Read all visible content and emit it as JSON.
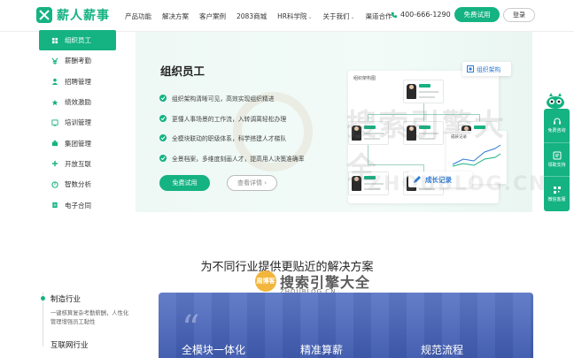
{
  "brand": {
    "name": "薪人薪事",
    "color": "#15b282"
  },
  "nav": {
    "items": [
      {
        "label": "产品功能",
        "caret": false
      },
      {
        "label": "解决方案",
        "caret": false
      },
      {
        "label": "客户案例",
        "caret": false
      },
      {
        "label": "2083商城",
        "caret": false
      },
      {
        "label": "HR科学院",
        "caret": true
      },
      {
        "label": "关于我们",
        "caret": true
      },
      {
        "label": "渠道合作",
        "caret": false
      }
    ],
    "caret_glyph": "⌄",
    "phone": "400-666-1290",
    "trial_label": "免费试用",
    "login_label": "登录"
  },
  "sidebar": {
    "items": [
      {
        "label": "组织员工",
        "icon": "org-icon"
      },
      {
        "label": "薪酬考勤",
        "icon": "yen-icon"
      },
      {
        "label": "招聘管理",
        "icon": "recruit-icon"
      },
      {
        "label": "绩效激励",
        "icon": "performance-icon"
      },
      {
        "label": "培训管理",
        "icon": "training-icon"
      },
      {
        "label": "集团管理",
        "icon": "group-icon"
      },
      {
        "label": "开放互联",
        "icon": "open-icon"
      },
      {
        "label": "智数分析",
        "icon": "analytics-icon"
      },
      {
        "label": "电子合同",
        "icon": "contract-icon"
      }
    ]
  },
  "hero": {
    "title": "组织员工",
    "bullets": [
      "组织架构清晰可见，高效实现组织精进",
      "更懂人事场景的工作流，入转调离轻松办理",
      "全模块联动的职级体系，科学搭建人才梯队",
      "全景档案，多维度刻画人才，提高用人决策准确率"
    ],
    "trial_label": "免费试用",
    "detail_label": "查看详情",
    "detail_arrow": "›",
    "tag_org": "组织架构",
    "tag_growth": "成长记录",
    "org_window_title": "组织架构图",
    "growth_window_title": "成长记录"
  },
  "float": {
    "items": [
      {
        "label": "免费咨询",
        "icon": "headset-icon"
      },
      {
        "label": "领取支持",
        "icon": "gift-icon"
      },
      {
        "label": "微信客服",
        "icon": "qrcode-icon"
      }
    ]
  },
  "solutions": {
    "title": "为不同行业提供更贴近的解决方案",
    "industries": [
      {
        "name": "制造行业",
        "desc": "一键核算复杂考勤薪酬，人性化管理增强员工黏性"
      },
      {
        "name": "互联网行业",
        "desc": ""
      }
    ],
    "banner_quote": "“",
    "banner_captions": [
      "全模块一体化",
      "精准算薪",
      "规范流程"
    ]
  },
  "watermarks": {
    "big": "搜索引擎大全",
    "sub": "ZHOUBLOG.CN",
    "badge": "周博客",
    "small": "搜索引擎大全",
    "small_sub": "ZHOUBLOG.CN"
  }
}
